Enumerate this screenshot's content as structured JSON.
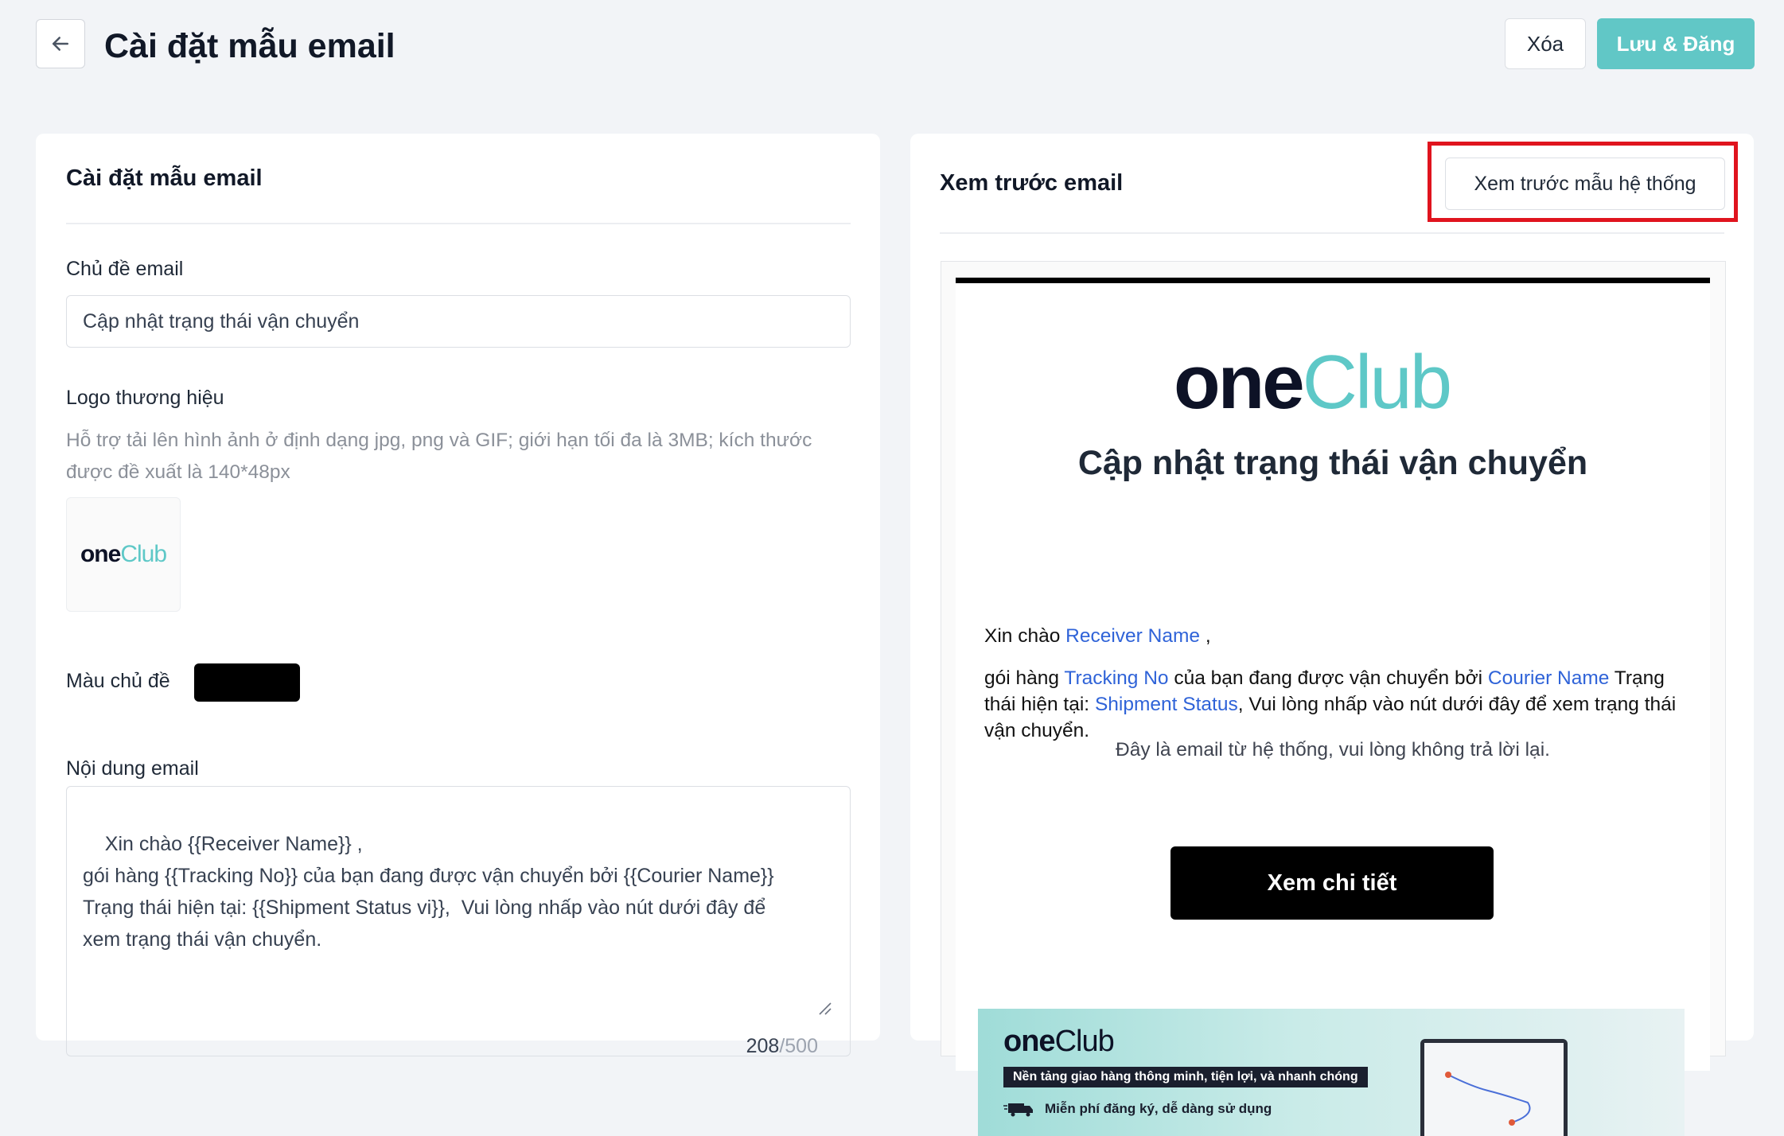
{
  "header": {
    "title": "Cài đặt mẫu email",
    "delete_label": "Xóa",
    "save_label": "Lưu & Đăng"
  },
  "settings": {
    "section_title": "Cài đặt mẫu email",
    "subject_label": "Chủ đề email",
    "subject_value": "Cập nhật trạng thái vận chuyển",
    "logo_label": "Logo thương hiệu",
    "logo_hint": "Hỗ trợ tải lên hình ảnh ở định dạng jpg, png và GIF; giới hạn tối đa là 3MB; kích thước được đề xuất là 140*48px",
    "theme_color_label": "Màu chủ đề",
    "theme_color": "#000000",
    "content_label": "Nội dung email",
    "content_value": "Xin chào {{Receiver Name}} ,\ngói hàng {{Tracking No}} của bạn đang được vận chuyển bởi {{Courier Name}}\nTrạng thái hiện tại: {{Shipment Status vi}},  Vui lòng nhấp vào nút dưới đây để\nxem trạng thái vận chuyển.",
    "char_count": "208",
    "char_max": "/500"
  },
  "preview": {
    "section_title": "Xem trước email",
    "system_template_button": "Xem trước mẫu hệ thống",
    "email": {
      "title": "Cập nhật trạng thái vận chuyển",
      "greeting_prefix": "Xin chào",
      "receiver_name": "Receiver Name",
      "greeting_suffix": ",",
      "body_1": "gói hàng",
      "tracking_no": "Tracking No",
      "body_2": "của bạn đang được vận chuyển bởi",
      "courier_name": "Courier Name",
      "body_3": "Trạng thái hiện tại:",
      "shipment_status": "Shipment Status",
      "body_4": ",   Vui lòng nhấp vào nút dưới đây để xem trạng thái vận chuyển.",
      "noreply": "Đây là email từ hệ thống, vui lòng không trả lời lại.",
      "button": "Xem chi tiết",
      "banner_tagline": "Nền tảng giao hàng thông minh, tiện lợi, và nhanh chóng",
      "banner_line": "Miễn phí đăng ký, dễ dàng sử dụng"
    }
  },
  "brand": {
    "part1": "one",
    "part2": "Club",
    "color_dark": "#0d1226",
    "color_teal": "#5ec8c7"
  },
  "colors": {
    "accent": "#61c7c6",
    "link": "#2f63d8",
    "highlight": "#e0141e"
  },
  "icons": [
    "back-arrow-icon",
    "resize-handle-icon",
    "truck-icon"
  ]
}
